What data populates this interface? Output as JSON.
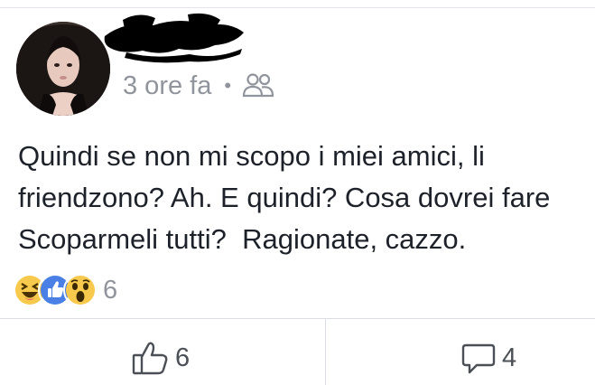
{
  "post": {
    "author_name": "",
    "timestamp": "3 ore fa",
    "separator": "•",
    "audience_icon": "friends-icon",
    "text": "Quindi se non mi scopo i miei amici, li friendzono? Ah. E quindi? Cosa dovrei fare Scoparmeli tutti?  Ragionate, cazzo."
  },
  "reactions": {
    "icons": [
      "haha-icon",
      "like-icon",
      "wow-icon"
    ],
    "count": "6"
  },
  "actions": {
    "like_count": "6",
    "comment_count": "4"
  },
  "colors": {
    "like_blue": "#3b5998",
    "reaction_yellow": "#f7c94d",
    "meta_gray": "#90949c",
    "text": "#1d2129",
    "divider": "#dadde1"
  }
}
